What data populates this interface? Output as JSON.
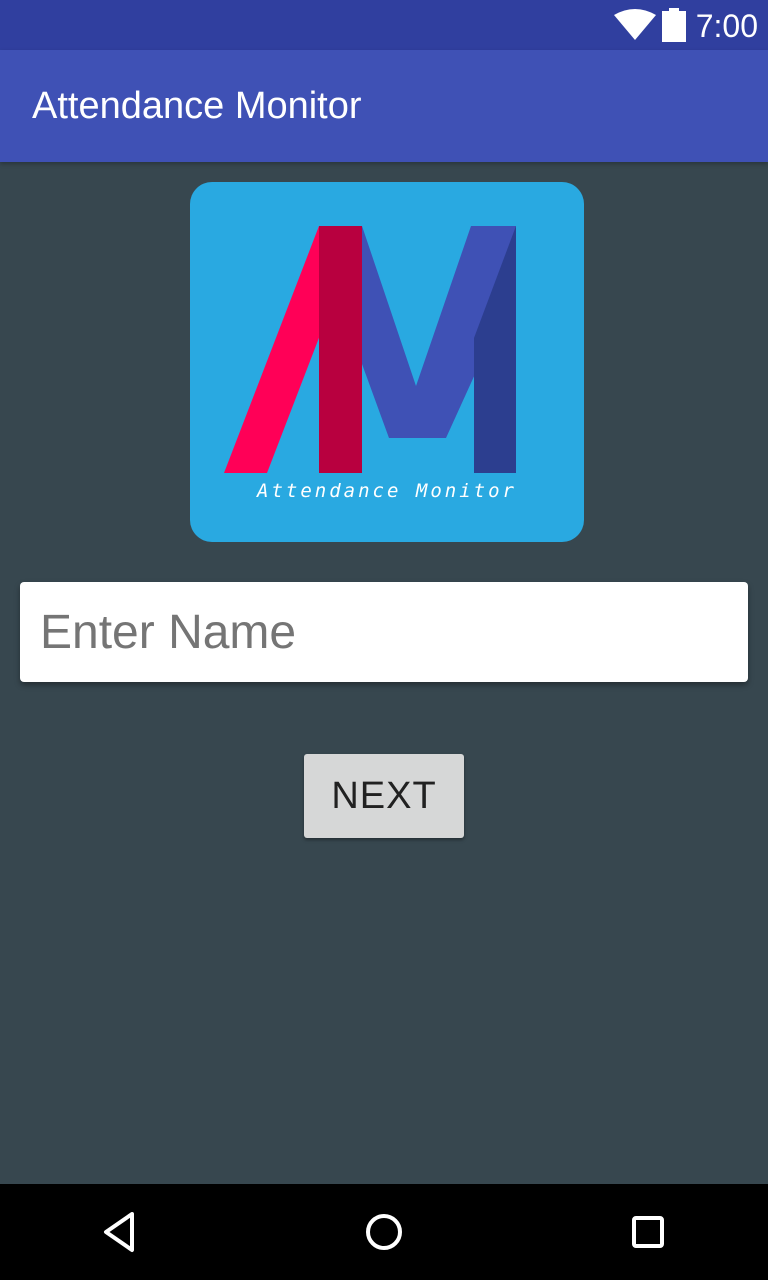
{
  "status_bar": {
    "time": "7:00",
    "icons": [
      "wifi-icon",
      "battery-icon"
    ]
  },
  "app_bar": {
    "title": "Attendance Monitor"
  },
  "logo": {
    "caption": "Attendance Monitor",
    "colors": {
      "background": "#29A9E1",
      "pink": "#FF0057",
      "crimson": "#B8003F",
      "indigo": "#3F51B5",
      "navy": "#2C3E8F"
    }
  },
  "form": {
    "name_placeholder": "Enter Name",
    "name_value": "",
    "next_label": "NEXT"
  },
  "nav_bar": {
    "icons": [
      "back-icon",
      "home-icon",
      "recents-icon"
    ]
  },
  "colors": {
    "status_bar": "#303F9F",
    "app_bar": "#3F51B5",
    "background": "#37474F",
    "button": "#D6D7D7"
  }
}
